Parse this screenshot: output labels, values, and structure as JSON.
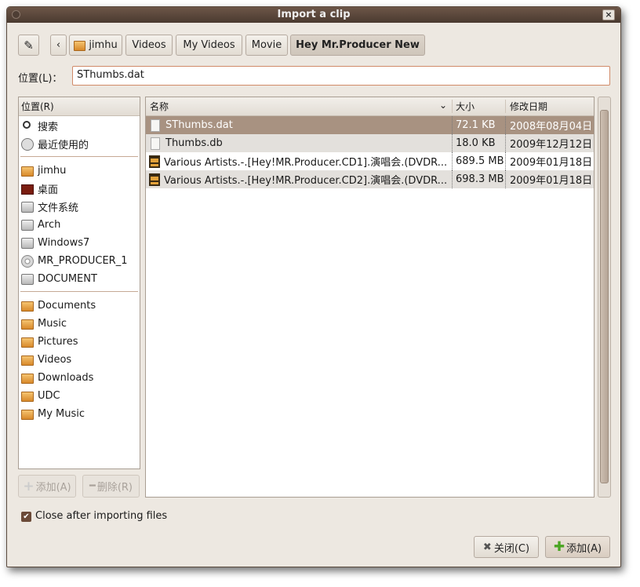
{
  "window": {
    "title": "Import a clip",
    "close": "×"
  },
  "pathbar": {
    "back": "‹",
    "crumbs": [
      "jimhu",
      "Videos",
      "My Videos",
      "Movie",
      "Hey Mr.Producer New"
    ]
  },
  "location": {
    "label": "位置(L)：",
    "value": "SThumbs.dat"
  },
  "places": {
    "header": "位置(R)",
    "items": [
      {
        "label": "搜索",
        "icon": "search"
      },
      {
        "label": "最近使用的",
        "icon": "clock"
      },
      {
        "sep": true
      },
      {
        "label": "jimhu",
        "icon": "home-folder"
      },
      {
        "label": "桌面",
        "icon": "desktop"
      },
      {
        "label": "文件系统",
        "icon": "drive"
      },
      {
        "label": "Arch",
        "icon": "drive"
      },
      {
        "label": "Windows7",
        "icon": "drive"
      },
      {
        "label": "MR_PRODUCER_1",
        "icon": "disc"
      },
      {
        "label": "DOCUMENT",
        "icon": "drive"
      },
      {
        "sep": true
      },
      {
        "label": "Documents",
        "icon": "folder"
      },
      {
        "label": "Music",
        "icon": "folder"
      },
      {
        "label": "Pictures",
        "icon": "folder"
      },
      {
        "label": "Videos",
        "icon": "folder"
      },
      {
        "label": "Downloads",
        "icon": "folder"
      },
      {
        "label": "UDC",
        "icon": "folder"
      },
      {
        "label": "My Music",
        "icon": "folder"
      }
    ],
    "add": "添加(A)",
    "remove": "删除(R)"
  },
  "files": {
    "columns": [
      "名称",
      "大小",
      "修改日期"
    ],
    "rows": [
      {
        "name": "SThumbs.dat",
        "size": "72.1 KB",
        "date": "2008年08月04日",
        "icon": "file",
        "selected": true
      },
      {
        "name": "Thumbs.db",
        "size": "18.0 KB",
        "date": "2009年12月12日",
        "icon": "file"
      },
      {
        "name": "Various Artists.-.[Hey!MR.Producer.CD1].演唱会.(DVDR...",
        "size": "689.5 MB",
        "date": "2009年01月18日",
        "icon": "film"
      },
      {
        "name": "Various Artists.-.[Hey!MR.Producer.CD2].演唱会.(DVDR...",
        "size": "698.3 MB",
        "date": "2009年01月18日",
        "icon": "film"
      }
    ]
  },
  "options": {
    "close_after": "Close after importing files",
    "close_after_checked": true
  },
  "actions": {
    "close": "关闭(C)",
    "add": "添加(A)"
  }
}
